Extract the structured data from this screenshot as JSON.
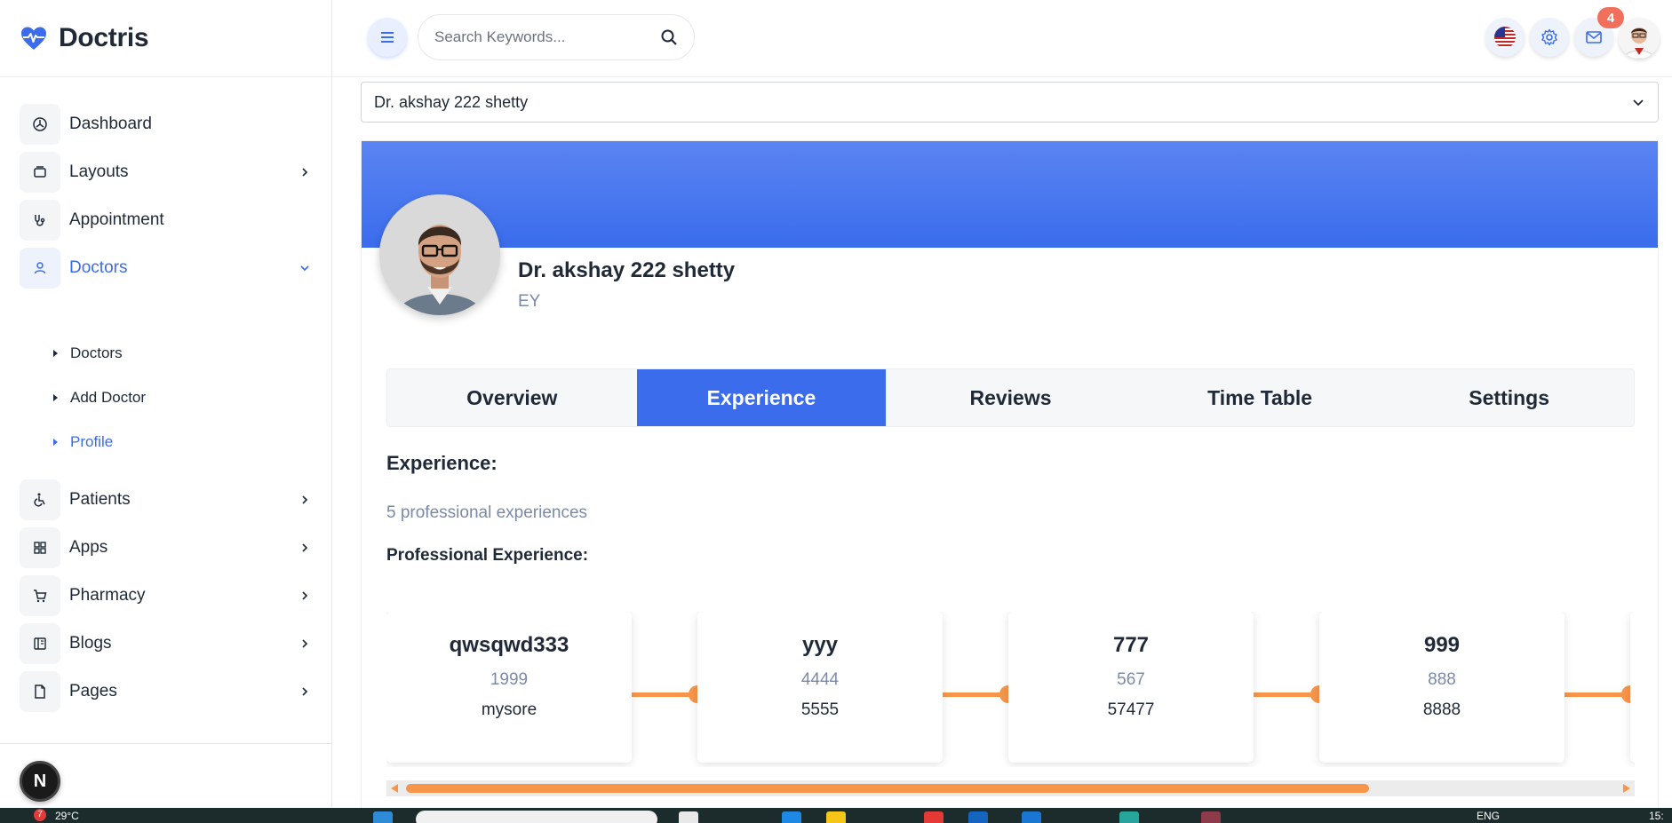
{
  "brand": {
    "name": "Doctris",
    "accent": "#3a6cec"
  },
  "sidebar": {
    "items": [
      {
        "label": "Dashboard",
        "icon": "dashboard-icon",
        "chevron": false
      },
      {
        "label": "Layouts",
        "icon": "layout-icon",
        "chevron": true
      },
      {
        "label": "Appointment",
        "icon": "stethoscope-icon",
        "chevron": false
      },
      {
        "label": "Doctors",
        "icon": "user-icon",
        "chevron": true,
        "active": true
      },
      {
        "label": "Patients",
        "icon": "wheelchair-icon",
        "chevron": true
      },
      {
        "label": "Apps",
        "icon": "apps-grid-icon",
        "chevron": true
      },
      {
        "label": "Pharmacy",
        "icon": "cart-icon",
        "chevron": true
      },
      {
        "label": "Blogs",
        "icon": "blog-icon",
        "chevron": true
      },
      {
        "label": "Pages",
        "icon": "page-icon",
        "chevron": true
      }
    ],
    "doctors_sub": [
      {
        "label": "Doctors"
      },
      {
        "label": "Add Doctor"
      },
      {
        "label": "Profile",
        "active": true
      }
    ],
    "footer_badge": "N"
  },
  "header": {
    "search_placeholder": "Search Keywords...",
    "notification_count": "4"
  },
  "main": {
    "doctor_select": "Dr. akshay 222 shetty",
    "profile": {
      "name": "Dr. akshay 222 shetty",
      "subtitle": "EY"
    },
    "tabs": [
      {
        "label": "Overview"
      },
      {
        "label": "Experience",
        "active": true
      },
      {
        "label": "Reviews"
      },
      {
        "label": "Time Table"
      },
      {
        "label": "Settings"
      }
    ],
    "experience": {
      "heading": "Experience:",
      "count_text": "5 professional experiences",
      "subheading": "Professional Experience:",
      "items": [
        {
          "title": "qwsqwd333",
          "year": "1999",
          "place": "mysore"
        },
        {
          "title": "yyy",
          "year": "4444",
          "place": "5555"
        },
        {
          "title": "777",
          "year": "567",
          "place": "57477"
        },
        {
          "title": "999",
          "year": "888",
          "place": "8888"
        }
      ]
    },
    "scroll_progress": 0.78
  },
  "taskbar": {
    "weather": "29°C",
    "weather_badge": "7",
    "lang": "ENG",
    "time": "15:"
  }
}
